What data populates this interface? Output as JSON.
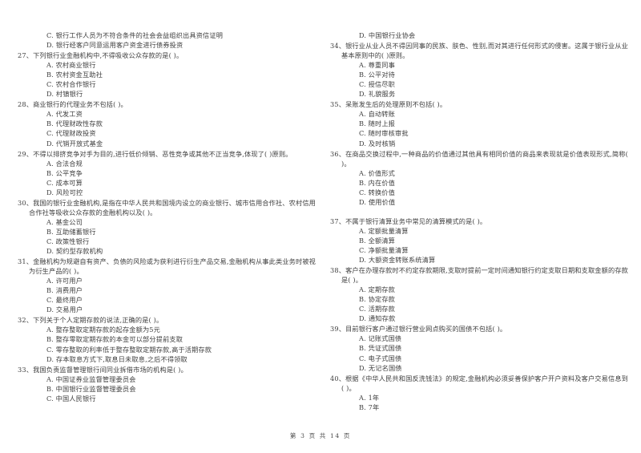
{
  "document": {
    "page_label": "第 3 页 共 14 页"
  },
  "left_column": {
    "orphan_options": [
      "C. 银行工作人员为不符合条件的社会会益组织出具资信证明",
      "D. 银行经客户同意运用客户资金进行债券投资"
    ],
    "questions": [
      {
        "number": "27、",
        "stem": "下列银行业金融机构中,不得吸收公众存款的是(        )。",
        "options": [
          "A. 农村商业银行",
          "B. 农村资金互助社",
          "C. 农村合作银行",
          "D. 村镇银行"
        ]
      },
      {
        "number": "28、",
        "stem": "商业银行的代理业务不包括(        )。",
        "options": [
          "A. 代发工资",
          "B. 代理财政性存款",
          "C. 代理财政投资",
          "D. 代销开放式基金"
        ]
      },
      {
        "number": "29、",
        "stem": "不得以排挤竞争对手为目的,进行低价倾销、恶性竞争或其他不正当竞争,体现了(        )原则。",
        "options": [
          "A. 合法合规",
          "B. 公平竞争",
          "C. 成本可算",
          "D. 风险可控"
        ]
      },
      {
        "number": "30、",
        "stem": "我国的银行业金融机构,是指在中华人民共和国境内设立的商业银行、城市信用合作社、农村信用合作社等吸收公众存款的金融机构以及(        )。",
        "options": [
          "A. 基金公司",
          "B. 互助储蓄银行",
          "C. 政策性银行",
          "D. 契约型存款机构"
        ]
      },
      {
        "number": "31、",
        "stem": "金融机构为规避自有资产、负债的风险或为获利进行衍生产品交易,金融机构从事此类业务时被视为衍生产品的(        )。",
        "options": [
          "A. 许可用户",
          "B. 消费用户",
          "C. 最终用户",
          "D. 交易用户"
        ]
      },
      {
        "number": "32、",
        "stem": "下列关于个人定期存款的说法,正确的是(        )。",
        "options": [
          "A. 整存整取定期存款的起存金额为5元",
          "B. 整存零取定期存款的本金可以部分提前支取",
          "C. 零存整取的利率低于整存整取定期存款,高于活期存款",
          "D. 存本取息方式下,取息日未取息,之后不得领取"
        ]
      },
      {
        "number": "33、",
        "stem": "我国负责监督管理银行间同业拆借市场的机构是(        )。",
        "options": [
          "A. 中国证券业监督管理委员会",
          "B. 中国银行业监督管理委员会",
          "C. 中国人民银行"
        ]
      }
    ]
  },
  "right_column": {
    "orphan_options": [
      "D. 中国银行业协会"
    ],
    "questions": [
      {
        "number": "34、",
        "stem": "银行业从业人员不得因同事的民族、肤色、性别,而对其进行任何形式的侵害。这属于银行业从业基本原则中的(        )原则。",
        "options": [
          "A. 尊重同事",
          "B. 公平对待",
          "C. 授信尽职",
          "D. 礼貌服务"
        ]
      },
      {
        "number": "35、",
        "stem": "呆账发生后的处理原则不包括(        )。",
        "options": [
          "A. 自动转账",
          "B. 随时上报",
          "C. 随时审核审批",
          "D. 及时核销"
        ]
      },
      {
        "number": "36、",
        "stem": "在商品交换过程中,一种商品的价值通过其他具有相同价值的商品来表现就是价值表现形式,简称(        )。",
        "options": [
          "A. 价值形式",
          "B. 内在价值",
          "C. 转换价值",
          "D. 使用价值"
        ]
      },
      {
        "number": "37、",
        "stem": "不属于银行清算业务中常见的清算模式的是(        )。",
        "options": [
          "A. 定额批量清算",
          "B. 全额清算",
          "C. 净额批量清算",
          "D. 大额资金转账系统清算"
        ]
      },
      {
        "number": "38、",
        "stem": "客户在办理存款时不约定存款期限,支取时提前一定时间通知银行约定支取日期和支取金额的存款是(        )。",
        "options": [
          "A. 定期存款",
          "B. 协定存款",
          "C. 活期存款",
          "D. 通知存款"
        ]
      },
      {
        "number": "39、",
        "stem": "目前银行客户通过银行营业网点购买的国债不包括(        )。",
        "options": [
          "A. 记账式国债",
          "B. 凭证式国债",
          "C. 电子式国债",
          "D. 无记名国债"
        ]
      },
      {
        "number": "40、",
        "stem": "根据《中华人民共和国反洗钱法》的规定,金融机构必须妥善保护客户开户资料及客户交易信息到(        )。",
        "options": [
          "A. 1年",
          "B. 7年"
        ]
      }
    ]
  }
}
